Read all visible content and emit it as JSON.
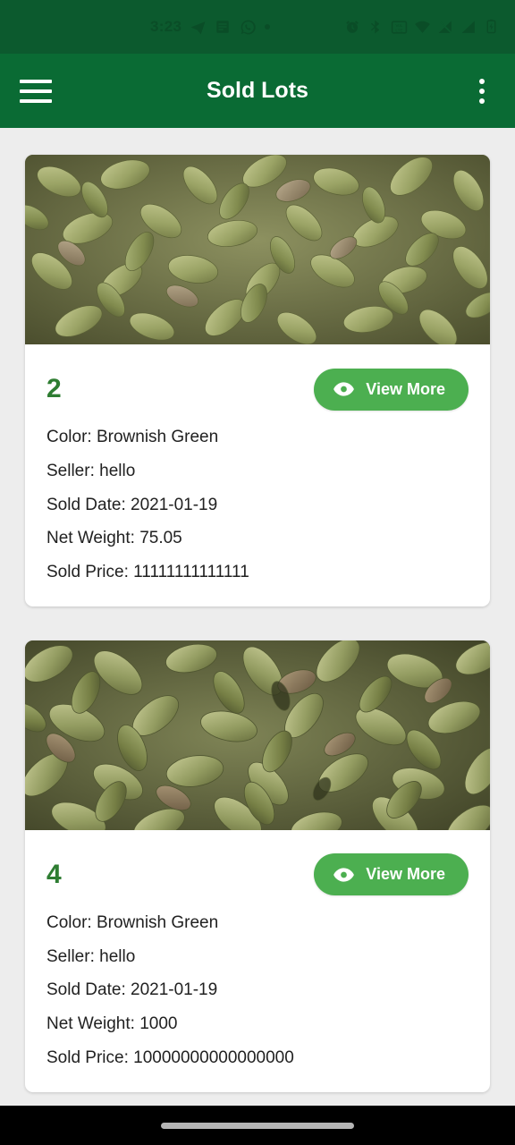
{
  "status_bar": {
    "time": "3:23",
    "left_icons": [
      "telegram-icon",
      "notes-icon",
      "whatsapp-icon",
      "notification-dot"
    ],
    "right_icons": [
      "alarm-icon",
      "bluetooth-icon",
      "volte-icon",
      "wifi-icon",
      "signal-muted-icon",
      "signal-icon",
      "battery-icon"
    ],
    "background": "#0c5a2e"
  },
  "app_bar": {
    "title": "Sold Lots",
    "menu_icon": "hamburger-menu-icon",
    "overflow_icon": "more-vertical-icon",
    "background": "#0a6b34",
    "title_color": "#ffffff"
  },
  "theme": {
    "page_background": "#ededed",
    "card_background": "#ffffff",
    "lot_number_color": "#2e7d32",
    "button_color": "#4caf50",
    "text_color": "#212121"
  },
  "labels": {
    "color": "Color:",
    "seller": "Seller:",
    "sold_date": "Sold Date:",
    "net_weight": "Net Weight:",
    "sold_price": "Sold Price:",
    "view_more": "View More"
  },
  "lots": [
    {
      "lot_number": "2",
      "image_alt": "green-cardamom-pods",
      "color": "Color: Brownish Green",
      "seller": "Seller: hello",
      "sold_date": "Sold Date: 2021-01-19",
      "net_weight": "Net Weight: 75.05",
      "sold_price": "Sold Price: 11111111111111",
      "button_label": "View More"
    },
    {
      "lot_number": "4",
      "image_alt": "green-cardamom-pods",
      "color": "Color: Brownish Green",
      "seller": "Seller: hello",
      "sold_date": "Sold Date: 2021-01-19",
      "net_weight": "Net Weight: 1000",
      "sold_price": "Sold Price: 10000000000000000",
      "button_label": "View More"
    }
  ],
  "nav_bar": {
    "home_indicator": "home-indicator",
    "background": "#000000"
  }
}
